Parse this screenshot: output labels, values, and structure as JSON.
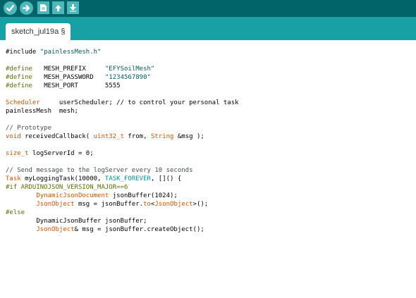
{
  "toolbar": {
    "buttons": [
      {
        "name": "verify-button",
        "icon": "checkmark-icon"
      },
      {
        "name": "upload-button",
        "icon": "arrow-right-icon"
      },
      {
        "name": "new-button",
        "icon": "new-file-icon"
      },
      {
        "name": "open-button",
        "icon": "arrow-up-icon"
      },
      {
        "name": "save-button",
        "icon": "arrow-down-icon"
      }
    ],
    "icon_color": "#ffffff",
    "button_color": "#4db7bb",
    "background": "#006468"
  },
  "tabs": [
    {
      "label": "sketch_jul19a §"
    }
  ],
  "colors": {
    "tabstrip": "#17a1a5",
    "preprocessor": "#5e6d03",
    "string": "#005c5f",
    "type": "#d35400",
    "comment": "#434f54",
    "constant": "#00979c"
  },
  "code_lines": [
    [
      {
        "t": "#include ",
        "c": "k-plain"
      },
      {
        "t": "\"painlessMesh.h\"",
        "c": "k-str"
      }
    ],
    [],
    [
      {
        "t": "#define",
        "c": "k-pre"
      },
      {
        "t": "   MESH_PREFIX     ",
        "c": "k-plain"
      },
      {
        "t": "\"EFYSoilMesh\"",
        "c": "k-str"
      }
    ],
    [
      {
        "t": "#define",
        "c": "k-pre"
      },
      {
        "t": "   MESH_PASSWORD   ",
        "c": "k-plain"
      },
      {
        "t": "\"1234567890\"",
        "c": "k-str"
      }
    ],
    [
      {
        "t": "#define",
        "c": "k-pre"
      },
      {
        "t": "   MESH_PORT       5555",
        "c": "k-plain"
      }
    ],
    [],
    [
      {
        "t": "Scheduler",
        "c": "k-type"
      },
      {
        "t": "     userScheduler; // to control your personal task",
        "c": "k-plain"
      }
    ],
    [
      {
        "t": "painlessMesh  mesh;",
        "c": "k-plain"
      }
    ],
    [],
    [
      {
        "t": "// Prototype",
        "c": "k-cmt"
      }
    ],
    [
      {
        "t": "void",
        "c": "k-type"
      },
      {
        "t": " receivedCallback( ",
        "c": "k-plain"
      },
      {
        "t": "uint32_t",
        "c": "k-type"
      },
      {
        "t": " from, ",
        "c": "k-plain"
      },
      {
        "t": "String",
        "c": "k-type"
      },
      {
        "t": " &msg );",
        "c": "k-plain"
      }
    ],
    [],
    [
      {
        "t": "size_t",
        "c": "k-type"
      },
      {
        "t": " logServerId = 0;",
        "c": "k-plain"
      }
    ],
    [],
    [
      {
        "t": "// Send message to the logServer every 10 seconds",
        "c": "k-cmt"
      }
    ],
    [
      {
        "t": "Task",
        "c": "k-type"
      },
      {
        "t": " myLoggingTask(10000, ",
        "c": "k-plain"
      },
      {
        "t": "TASK_FOREVER",
        "c": "k-const"
      },
      {
        "t": ", []() {",
        "c": "k-plain"
      }
    ],
    [
      {
        "t": "#if ARDUINOJSON_VERSION_MAJOR==6",
        "c": "k-pre"
      }
    ],
    [
      {
        "t": "        ",
        "c": "k-plain"
      },
      {
        "t": "DynamicJsonDocument",
        "c": "k-type"
      },
      {
        "t": " jsonBuffer(1024);",
        "c": "k-plain"
      }
    ],
    [
      {
        "t": "        ",
        "c": "k-plain"
      },
      {
        "t": "JsonObject",
        "c": "k-type"
      },
      {
        "t": " msg = jsonBuffer.",
        "c": "k-plain"
      },
      {
        "t": "to",
        "c": "k-fn"
      },
      {
        "t": "<",
        "c": "k-plain"
      },
      {
        "t": "JsonObject",
        "c": "k-type"
      },
      {
        "t": ">();",
        "c": "k-plain"
      }
    ],
    [
      {
        "t": "#else",
        "c": "k-pre"
      }
    ],
    [
      {
        "t": "        DynamicJsonBuffer jsonBuffer;",
        "c": "k-plain"
      }
    ],
    [
      {
        "t": "        ",
        "c": "k-plain"
      },
      {
        "t": "JsonObject",
        "c": "k-type"
      },
      {
        "t": "& msg = jsonBuffer.createObject();",
        "c": "k-plain"
      }
    ]
  ]
}
